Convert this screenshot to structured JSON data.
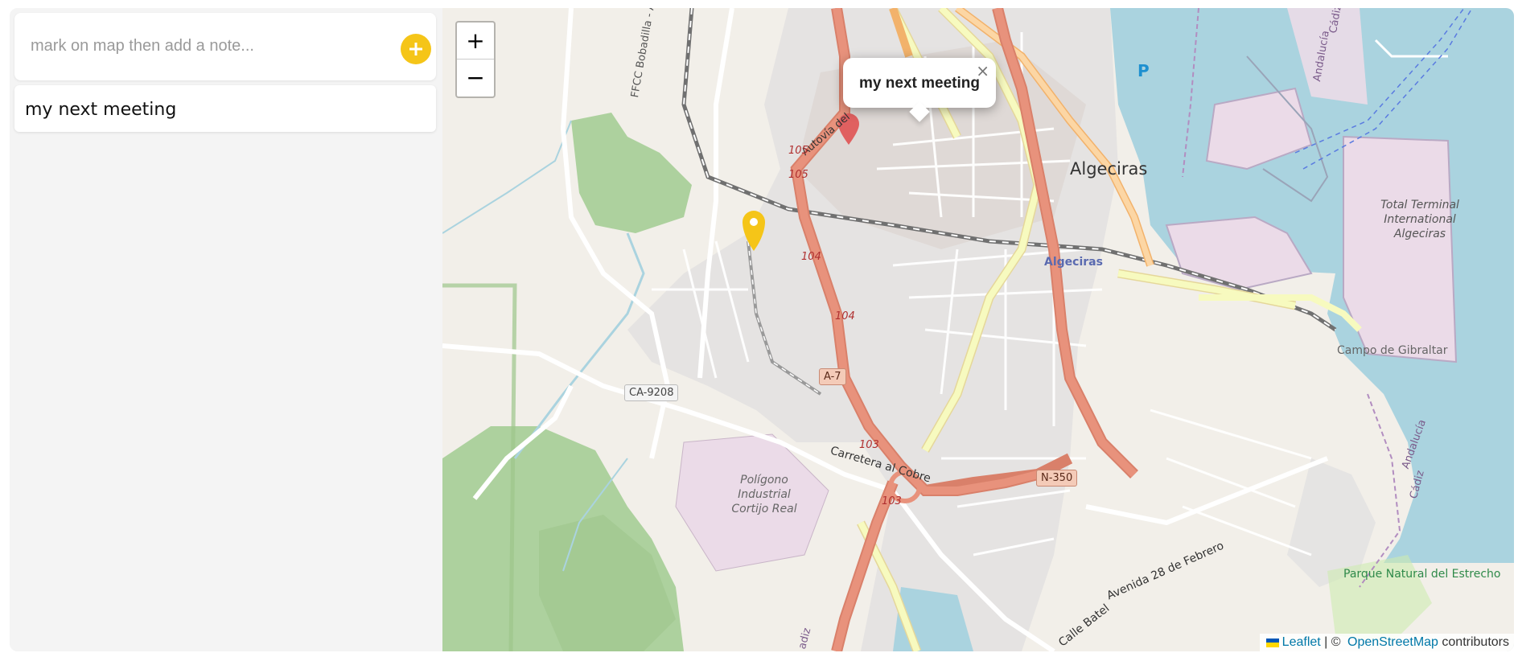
{
  "sidebar": {
    "note_input_placeholder": "mark on map then add a note...",
    "add_button_icon": "plus-icon",
    "notes": [
      {
        "label": "my next meeting"
      }
    ]
  },
  "map": {
    "zoom_in_label": "+",
    "zoom_out_label": "−",
    "popup": {
      "text": "my next meeting",
      "close_label": "×"
    },
    "attribution": {
      "leaflet_label": "Leaflet",
      "separator": " | © ",
      "osm_label": "OpenStreetMap",
      "suffix": " contributors"
    },
    "labels": {
      "city": "Algeciras",
      "station": "Algeciras",
      "terminal": "Total Terminal International Algeciras",
      "port": "Campo de Gibraltar",
      "industrial": "Polígono Industrial Cortijo Real",
      "park": "Parque Natural del Estrecho",
      "carretera": "Carretera al Cobre",
      "avenida": "Avenida 28 de Febrero",
      "calle": "Calle Batel",
      "railway": "FFCC Bobadilla - Algeciras",
      "autovia": "Autovía del",
      "andalucia1": "Andalucía",
      "andalucia2": "Andalucía",
      "cadiz1": "Cádiz",
      "cadiz2": "Cádiz",
      "cadiz3": "adiz",
      "parking": "P"
    },
    "road_refs": {
      "ca9208": "CA-9208",
      "a7": "A-7",
      "n350": "N-350",
      "km105a": "105",
      "km105b": "105",
      "km104a": "104",
      "km104b": "104",
      "km103a": "103",
      "km103b": "103"
    },
    "colors": {
      "marker_yellow": "#f5c518",
      "marker_red": "#e06060",
      "water": "#aad3df",
      "forest": "#add19e",
      "industrial": "#ebdbe8",
      "motorway": "#e8927c",
      "primary": "#f7fabf"
    }
  }
}
